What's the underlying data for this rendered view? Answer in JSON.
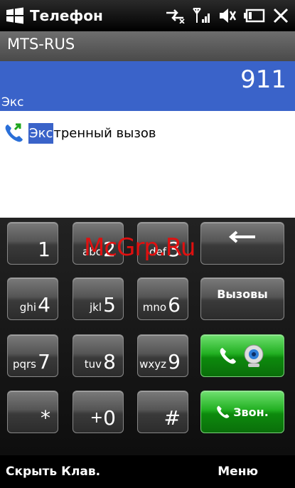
{
  "statusbar": {
    "title": "Телефон",
    "icons": [
      "windows-logo",
      "data-connection-icon",
      "signal-icon",
      "volume-icon",
      "battery-icon",
      "close-icon"
    ]
  },
  "operator": "MTS-RUS",
  "dialer": {
    "number": "911",
    "matched_text": "Экс"
  },
  "suggestion": {
    "match": "Экс",
    "rest": "тренный вызов"
  },
  "keypad": {
    "keys": [
      {
        "digit": "1",
        "letters": ""
      },
      {
        "digit": "2",
        "letters": "abc"
      },
      {
        "digit": "3",
        "letters": "def"
      },
      {
        "digit": "4",
        "letters": "ghi"
      },
      {
        "digit": "5",
        "letters": "jkl"
      },
      {
        "digit": "6",
        "letters": "mno"
      },
      {
        "digit": "7",
        "letters": "pqrs"
      },
      {
        "digit": "8",
        "letters": "tuv"
      },
      {
        "digit": "9",
        "letters": "wxyz"
      },
      {
        "digit": "*",
        "letters": ""
      },
      {
        "digit": "0",
        "letters": "+"
      },
      {
        "digit": "#",
        "letters": ""
      }
    ],
    "calls_label": "Вызовы",
    "call_label": "Звон.",
    "backspace_icon": "backspace-arrow-icon",
    "video_call_icon": "video-call-icon"
  },
  "watermark": "McGrp.Ru",
  "softkeys": {
    "left": "Скрыть Клав.",
    "right": "Меню"
  },
  "colors": {
    "selection_blue": "#3a63c9",
    "call_green": "#22b022",
    "watermark_red": "#e01010"
  }
}
